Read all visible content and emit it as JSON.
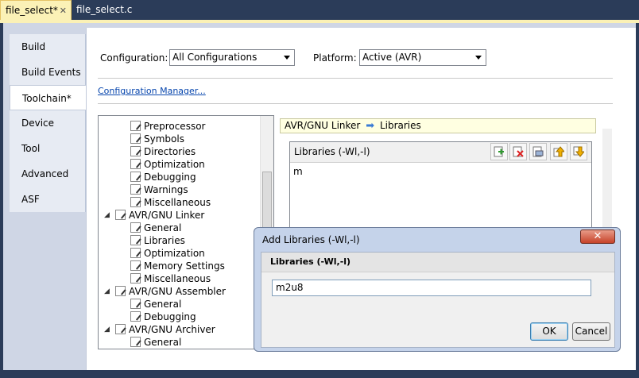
{
  "tabs": [
    {
      "label": "file_select*",
      "close": "✕"
    },
    {
      "label": "file_select.c"
    }
  ],
  "nav": [
    "Build",
    "Build Events",
    "Toolchain*",
    "Device",
    "Tool",
    "Advanced",
    "ASF"
  ],
  "config": {
    "configuration_label": "Configuration:",
    "configuration_value": "All Configurations",
    "platform_label": "Platform:",
    "platform_value": "Active (AVR)",
    "manager_link": "Configuration Manager..."
  },
  "tree": {
    "items": [
      {
        "text": "General",
        "level": 2
      },
      {
        "text": "Preprocessor",
        "level": 2
      },
      {
        "text": "Symbols",
        "level": 2
      },
      {
        "text": "Directories",
        "level": 2
      },
      {
        "text": "Optimization",
        "level": 2
      },
      {
        "text": "Debugging",
        "level": 2
      },
      {
        "text": "Warnings",
        "level": 2
      },
      {
        "text": "Miscellaneous",
        "level": 2
      },
      {
        "text": "AVR/GNU Linker",
        "level": 1
      },
      {
        "text": "General",
        "level": 2
      },
      {
        "text": "Libraries",
        "level": 2
      },
      {
        "text": "Optimization",
        "level": 2
      },
      {
        "text": "Memory Settings",
        "level": 2
      },
      {
        "text": "Miscellaneous",
        "level": 2
      },
      {
        "text": "AVR/GNU Assembler",
        "level": 1
      },
      {
        "text": "General",
        "level": 2
      },
      {
        "text": "Debugging",
        "level": 2
      },
      {
        "text": "AVR/GNU Archiver",
        "level": 1
      },
      {
        "text": "General",
        "level": 2
      }
    ]
  },
  "breadcrumb": {
    "part1": "AVR/GNU Linker",
    "part2": "Libraries"
  },
  "libraries": {
    "header": "Libraries (-Wl,-l)",
    "items": [
      "m"
    ],
    "toolbar": [
      "add-icon",
      "delete-icon",
      "edit-icon",
      "move-up-icon",
      "move-down-icon"
    ]
  },
  "dialog": {
    "title": "Add Libraries (-Wl,-l)",
    "close": "✕",
    "header": "Libraries (-Wl,-l)",
    "value": "m2u8",
    "ok": "OK",
    "cancel": "Cancel"
  }
}
